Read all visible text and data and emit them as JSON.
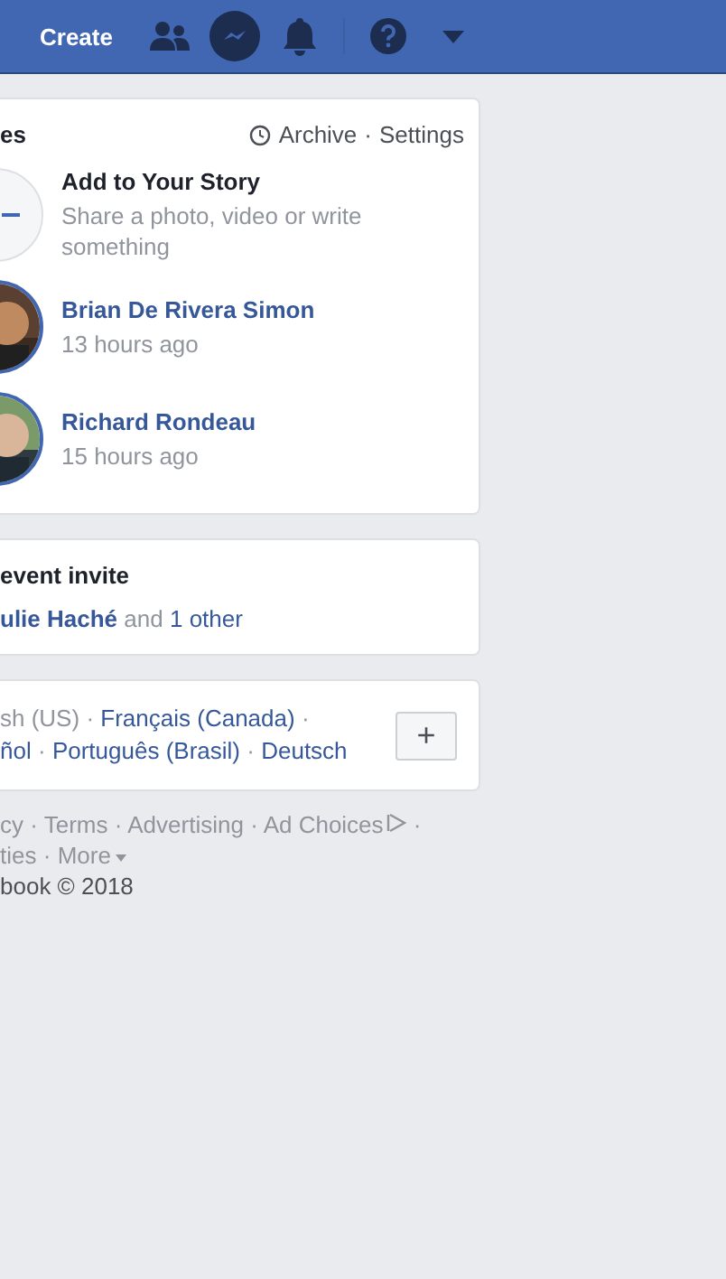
{
  "top_bar": {
    "create": "Create",
    "icons": [
      {
        "kind": "friends",
        "selected": false
      },
      {
        "kind": "messenger",
        "selected": true
      },
      {
        "kind": "bell",
        "selected": false
      },
      {
        "kind": "help",
        "selected": false
      },
      {
        "kind": "caret",
        "selected": false
      }
    ]
  },
  "stories": {
    "title": "es",
    "archive": "Archive",
    "separator": "·",
    "settings": "Settings",
    "items": [
      {
        "kind": "add",
        "name": "Add to Your Story",
        "detail": "Share a photo, video or write something"
      },
      {
        "kind": "story",
        "name": "Brian De Rivera Simon",
        "detail": "13 hours ago"
      },
      {
        "kind": "story",
        "name": "Richard Rondeau",
        "detail": "15 hours ago"
      }
    ]
  },
  "event": {
    "title": "event invite",
    "people": "ulie Haché",
    "joiner": "and",
    "others": "1 other"
  },
  "languages": {
    "separator": "·",
    "items": [
      {
        "label": "sh (US)",
        "selected": true
      },
      {
        "label": "Français (Canada)",
        "selected": false
      },
      {
        "label": "ñol",
        "selected": false
      },
      {
        "label": "Português (Brasil)",
        "selected": false
      },
      {
        "label": "Deutsch",
        "selected": false
      }
    ],
    "more": "+"
  },
  "footer": {
    "separator": "·",
    "links": [
      "cy",
      "Terms",
      "Advertising",
      "Ad Choices"
    ],
    "links2": [
      "ties",
      "More"
    ],
    "copyright": "book © 2018"
  }
}
